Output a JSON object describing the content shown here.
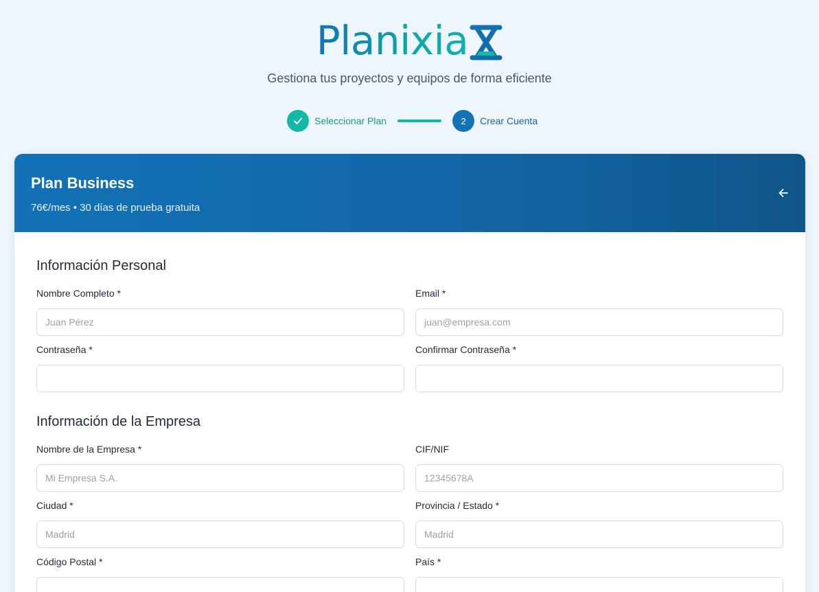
{
  "brand": {
    "name": "Planixia",
    "tagline": "Gestiona tus proyectos y equipos de forma eficiente",
    "colors": {
      "primary": "#1273b6",
      "accent": "#14b8a6"
    }
  },
  "stepper": {
    "steps": [
      {
        "label": "Seleccionar Plan",
        "status": "completed",
        "icon": "check-icon"
      },
      {
        "label": "Crear Cuenta",
        "status": "current",
        "number": "2"
      }
    ]
  },
  "plan": {
    "title": "Plan Business",
    "subtitle": "76€/mes • 30 días de prueba gratuita",
    "back_icon": "arrow-left-icon"
  },
  "sections": {
    "personal": {
      "title": "Información Personal",
      "fields": {
        "full_name": {
          "label": "Nombre Completo *",
          "placeholder": "Juan Pérez",
          "value": ""
        },
        "email": {
          "label": "Email *",
          "placeholder": "juan@empresa.com",
          "value": ""
        },
        "password": {
          "label": "Contraseña *",
          "placeholder": "",
          "value": ""
        },
        "confirm_password": {
          "label": "Confirmar Contraseña *",
          "placeholder": "",
          "value": ""
        }
      }
    },
    "company": {
      "title": "Información de la Empresa",
      "fields": {
        "company_name": {
          "label": "Nombre de la Empresa *",
          "placeholder": "Mi Empresa S.A.",
          "value": ""
        },
        "tax_id": {
          "label": "CIF/NIF",
          "placeholder": "12345678A",
          "value": ""
        },
        "city": {
          "label": "Ciudad *",
          "placeholder": "Madrid",
          "value": ""
        },
        "province": {
          "label": "Provincia / Estado *",
          "placeholder": "Madrid",
          "value": ""
        },
        "postal_code": {
          "label": "Código Postal *",
          "placeholder": "",
          "value": ""
        },
        "country": {
          "label": "País *",
          "placeholder": "",
          "value": ""
        }
      }
    }
  }
}
